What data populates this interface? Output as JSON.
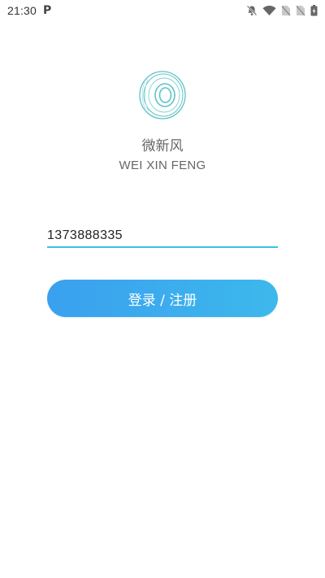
{
  "status_bar": {
    "time": "21:30",
    "notification_app_icon": "P",
    "icons": [
      "bell-off-icon",
      "wifi-icon",
      "no-sim-icon",
      "no-sim-icon",
      "battery-charging-icon"
    ]
  },
  "app": {
    "name_cn": "微新风",
    "name_en": "WEI XIN FENG",
    "logo_icon": "fan-ring-logo"
  },
  "form": {
    "phone_value": "1373888335",
    "login_button_label": "登录 / 注册"
  },
  "colors": {
    "accent": "#3ec0e6",
    "button_start": "#3aa0ef",
    "button_end": "#3db8ec",
    "logo_stroke": "#5ec3c4"
  }
}
